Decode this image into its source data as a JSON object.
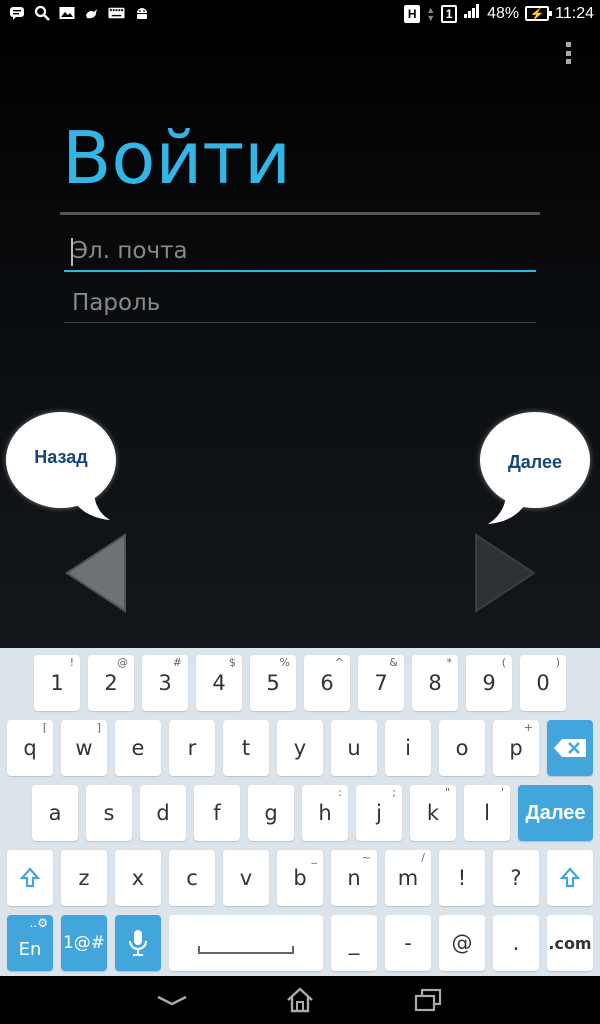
{
  "status_bar": {
    "h_label": "H",
    "sim_label": "1",
    "battery_percent": "48%",
    "time": "11:24",
    "left_icons": [
      "message-icon",
      "search-icon",
      "image-icon",
      "bird-icon",
      "keyboard-icon",
      "android-icon"
    ]
  },
  "login": {
    "title": "Войти",
    "email_placeholder": "Эл. почта",
    "password_placeholder": "Пароль",
    "back_label": "Назад",
    "next_label": "Далее"
  },
  "keyboard": {
    "row1": [
      {
        "k": "1",
        "s": "!"
      },
      {
        "k": "2",
        "s": "@"
      },
      {
        "k": "3",
        "s": "#"
      },
      {
        "k": "4",
        "s": "$"
      },
      {
        "k": "5",
        "s": "%"
      },
      {
        "k": "6",
        "s": "^"
      },
      {
        "k": "7",
        "s": "&"
      },
      {
        "k": "8",
        "s": "*"
      },
      {
        "k": "9",
        "s": "("
      },
      {
        "k": "0",
        "s": ")"
      }
    ],
    "row2": [
      {
        "k": "q",
        "s": "["
      },
      {
        "k": "w",
        "s": "]"
      },
      {
        "k": "e",
        "s": ""
      },
      {
        "k": "r",
        "s": ""
      },
      {
        "k": "t",
        "s": ""
      },
      {
        "k": "y",
        "s": ""
      },
      {
        "k": "u",
        "s": ""
      },
      {
        "k": "i",
        "s": ""
      },
      {
        "k": "o",
        "s": ""
      },
      {
        "k": "p",
        "s": "+"
      }
    ],
    "row3": [
      {
        "k": "a",
        "s": ""
      },
      {
        "k": "s",
        "s": ""
      },
      {
        "k": "d",
        "s": ""
      },
      {
        "k": "f",
        "s": ""
      },
      {
        "k": "g",
        "s": ""
      },
      {
        "k": "h",
        "s": ":"
      },
      {
        "k": "j",
        "s": ";"
      },
      {
        "k": "k",
        "s": "\""
      },
      {
        "k": "l",
        "s": "'"
      }
    ],
    "row4": [
      {
        "k": "z",
        "s": ""
      },
      {
        "k": "x",
        "s": ""
      },
      {
        "k": "c",
        "s": ""
      },
      {
        "k": "v",
        "s": ""
      },
      {
        "k": "b",
        "s": "_"
      },
      {
        "k": "n",
        "s": "~"
      },
      {
        "k": "m",
        "s": "/"
      },
      {
        "k": "!",
        "s": ""
      },
      {
        "k": "?",
        "s": ""
      }
    ],
    "next_key": "Далее",
    "lang_key": "En",
    "symbols_key": "1@#",
    "dash_key": "_",
    "minus_key": "-",
    "at_key": "@",
    "period_key": ".",
    "com_key": ".com"
  },
  "colors": {
    "accent": "#33b5e5",
    "key_blue": "#42a6dc",
    "bubble_text": "#16457a"
  }
}
